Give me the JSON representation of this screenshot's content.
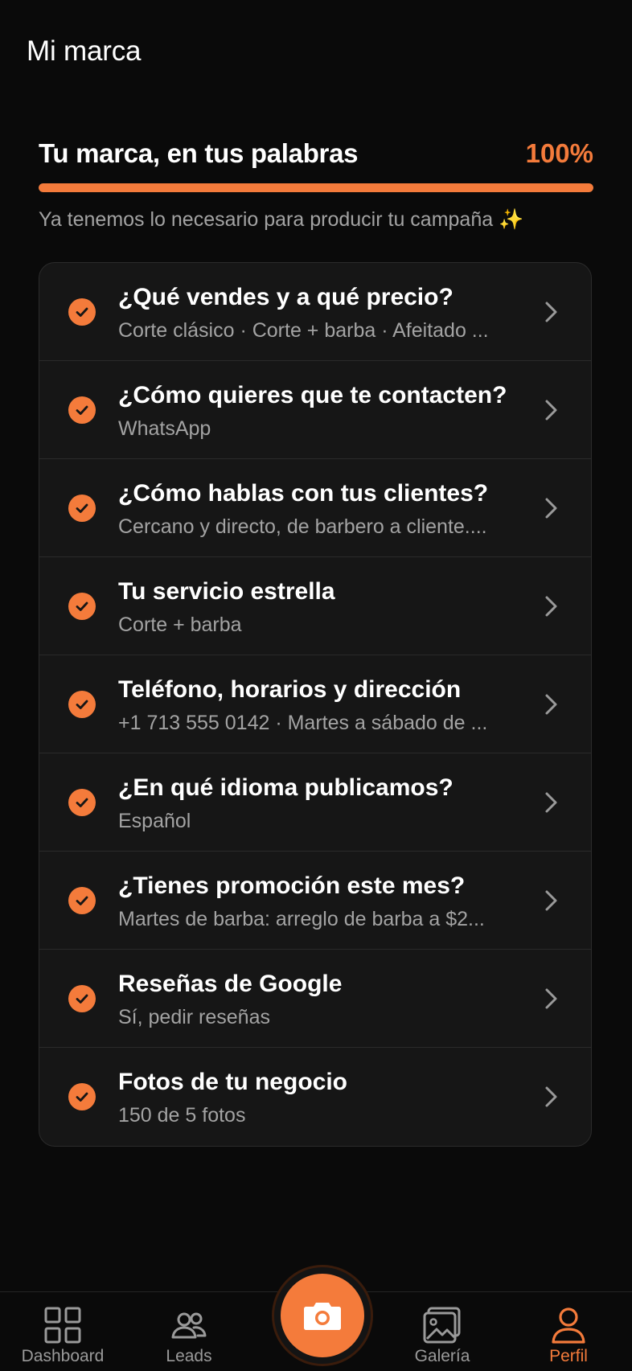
{
  "header": {
    "title": "Mi marca"
  },
  "progress": {
    "title": "Tu marca, en tus palabras",
    "percent_label": "100%",
    "value": 1.0,
    "note": "Ya tenemos lo necesario para producir tu campaña",
    "note_emoji": "✨"
  },
  "items": [
    {
      "title": "¿Qué vendes y a qué precio?",
      "subtitle": "Corte clásico · Corte + barba · Afeitado ..."
    },
    {
      "title": "¿Cómo quieres que te contacten?",
      "subtitle": "WhatsApp"
    },
    {
      "title": "¿Cómo hablas con tus clientes?",
      "subtitle": "Cercano y directo, de barbero a cliente...."
    },
    {
      "title": "Tu servicio estrella",
      "subtitle": "Corte + barba"
    },
    {
      "title": "Teléfono, horarios y dirección",
      "subtitle": "+1 713 555 0142 · Martes a sábado de ..."
    },
    {
      "title": "¿En qué idioma publicamos?",
      "subtitle": "Español"
    },
    {
      "title": "¿Tienes promoción este mes?",
      "subtitle": "Martes de barba: arreglo de barba a $2..."
    },
    {
      "title": "Reseñas de Google",
      "subtitle": "Sí, pedir reseñas"
    },
    {
      "title": "Fotos de tu negocio",
      "subtitle": "150 de 5 fotos"
    }
  ],
  "tabbar": {
    "tabs": [
      {
        "label": "Dashboard",
        "icon": "grid-icon"
      },
      {
        "label": "Leads",
        "icon": "users-icon"
      },
      {
        "label": "Galería",
        "icon": "gallery-icon"
      },
      {
        "label": "Perfil",
        "icon": "profile-icon",
        "active": true
      }
    ],
    "center_icon": "camera-icon"
  },
  "colors": {
    "accent": "#f47b3b",
    "background": "#0a0a0a",
    "card": "#161616"
  }
}
